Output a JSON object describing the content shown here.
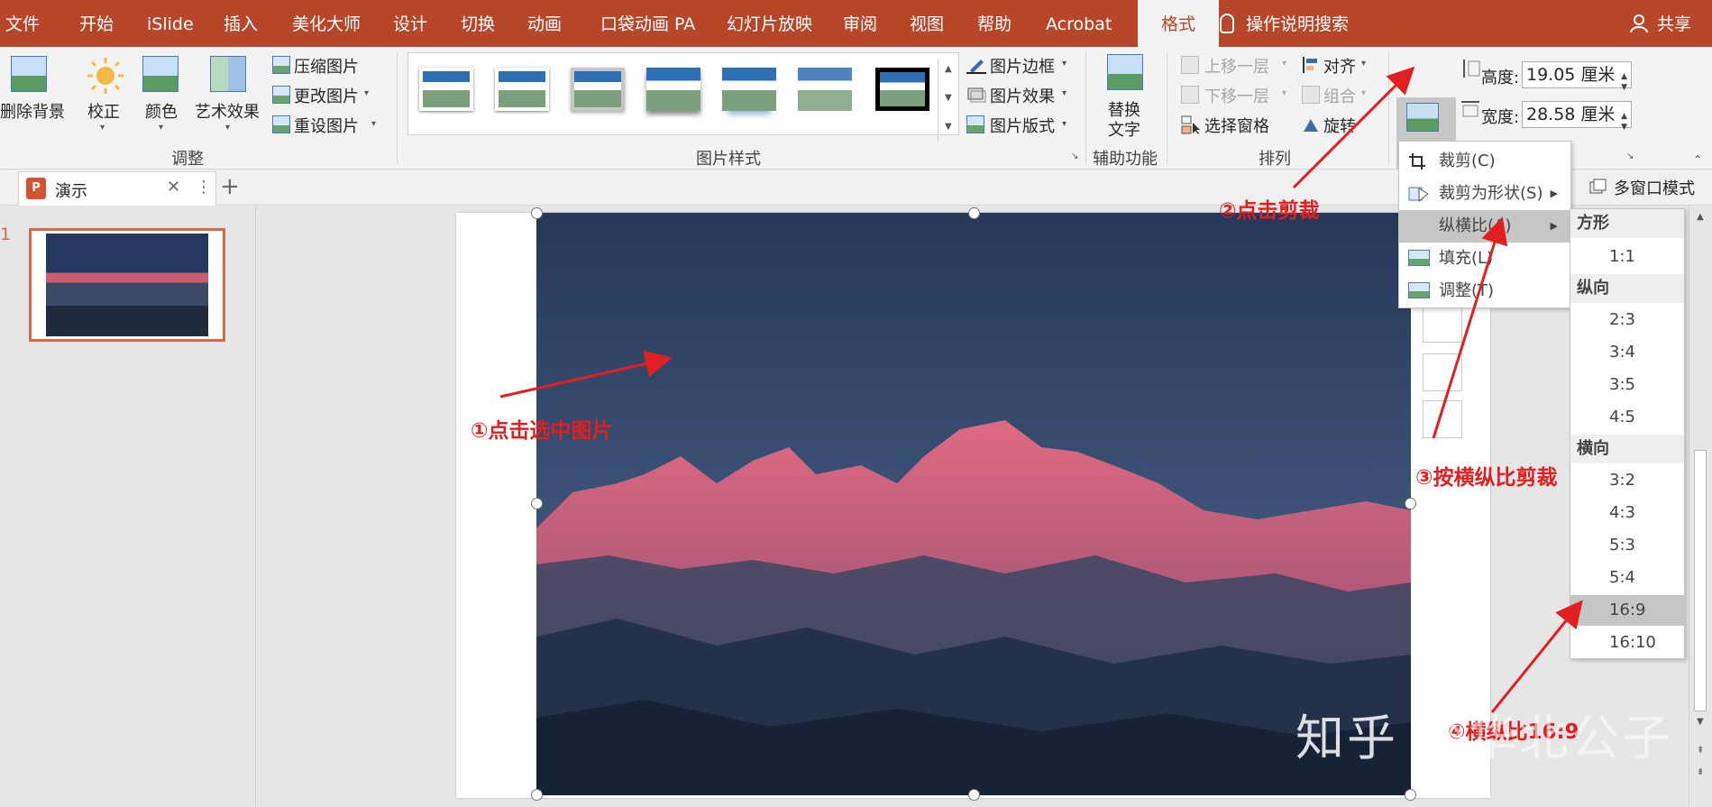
{
  "colors": {
    "brand": "#b7472a",
    "annotation": "#e02020",
    "selection": "#d36a4b"
  },
  "tabs": [
    {
      "label": "文件",
      "active": false
    },
    {
      "label": "开始",
      "active": false
    },
    {
      "label": "iSlide",
      "active": false
    },
    {
      "label": "插入",
      "active": false
    },
    {
      "label": "美化大师",
      "active": false
    },
    {
      "label": "设计",
      "active": false
    },
    {
      "label": "切换",
      "active": false
    },
    {
      "label": "动画",
      "active": false
    },
    {
      "label": "口袋动画 PA",
      "active": false
    },
    {
      "label": "幻灯片放映",
      "active": false
    },
    {
      "label": "审阅",
      "active": false
    },
    {
      "label": "视图",
      "active": false
    },
    {
      "label": "帮助",
      "active": false
    },
    {
      "label": "Acrobat",
      "active": false
    },
    {
      "label": "格式",
      "active": true
    }
  ],
  "tell_me": "操作说明搜索",
  "share": "共享",
  "ribbon": {
    "adjust": {
      "remove_bg": "删除背景",
      "corrections": "校正",
      "color": "颜色",
      "artistic": "艺术效果",
      "compress": "压缩图片",
      "change": "更改图片",
      "reset": "重设图片",
      "group_label": "调整"
    },
    "styles": {
      "border": "图片边框",
      "effects": "图片效果",
      "layout": "图片版式",
      "group_label": "图片样式"
    },
    "accessibility": {
      "alt_text_1": "替换",
      "alt_text_2": "文字",
      "group_label": "辅助功能"
    },
    "arrange": {
      "bring_forward": "上移一层",
      "send_backward": "下移一层",
      "selection_pane": "选择窗格",
      "align": "对齐",
      "group": "组合",
      "rotate": "旋转",
      "group_label": "排列"
    },
    "size": {
      "crop": "裁剪",
      "height_label": "高度:",
      "height_value": "19.05 厘米",
      "width_label": "宽度:",
      "width_value": "28.58 厘米"
    }
  },
  "doc_tab": {
    "name": "演示"
  },
  "multi_window": "多窗口模式",
  "slide_number": "1",
  "crop_menu": [
    {
      "label": "裁剪(C)",
      "has_sub": false,
      "highlighted": false
    },
    {
      "label": "裁剪为形状(S)",
      "has_sub": true,
      "highlighted": false
    },
    {
      "label": "纵横比(A)",
      "has_sub": true,
      "highlighted": true
    },
    {
      "label": "填充(L)",
      "has_sub": false,
      "highlighted": false
    },
    {
      "label": "调整(T)",
      "has_sub": false,
      "highlighted": false
    }
  ],
  "aspect_menu": {
    "square_header": "方形",
    "portrait_header": "纵向",
    "landscape_header": "横向",
    "square": [
      "1:1"
    ],
    "portrait": [
      "2:3",
      "3:4",
      "3:5",
      "4:5"
    ],
    "landscape": [
      "3:2",
      "4:3",
      "5:3",
      "5:4",
      "16:9",
      "16:10"
    ],
    "highlighted": "16:9"
  },
  "annotations": {
    "step1": "①点击选中图片",
    "step2": "②点击剪裁",
    "step3": "③按横纵比剪裁",
    "step4": "④横纵比16:9"
  },
  "watermark": {
    "site": "知乎",
    "author": "@华北公子"
  }
}
